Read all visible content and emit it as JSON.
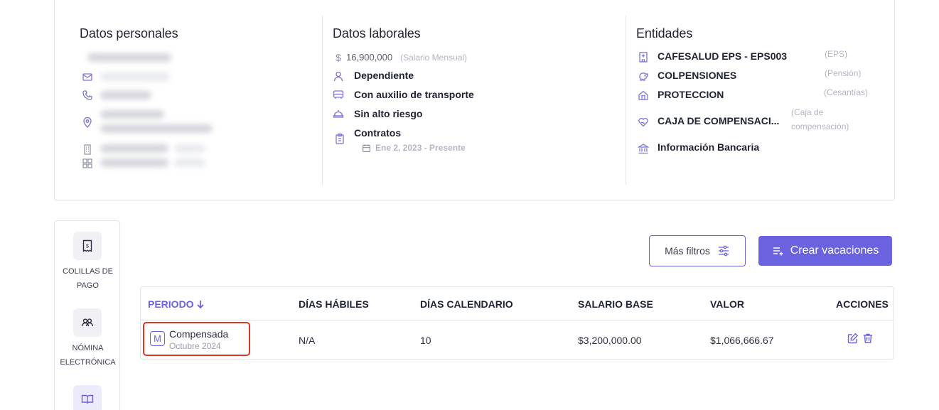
{
  "personal": {
    "title": "Datos personales"
  },
  "labor": {
    "title": "Datos laborales",
    "salary_value": "16,900,000",
    "salary_label": "(Salario Mensual)",
    "type": "Dependiente",
    "transport": "Con auxilio de transporte",
    "risk": "Sin alto riesgo",
    "contracts_label": "Contratos",
    "contract_date": "Ene 2, 2023 - Presente"
  },
  "entities": {
    "title": "Entidades",
    "items": [
      {
        "name": "CAFESALUD EPS - EPS003",
        "type": "(EPS)",
        "icon": "hospital-icon"
      },
      {
        "name": "COLPENSIONES",
        "type": "(Pensión)",
        "icon": "piggy-bank-icon"
      },
      {
        "name": "PROTECCION",
        "type": "(Cesantías)",
        "icon": "house-icon"
      },
      {
        "name": "CAJA DE COMPENSACI...",
        "type": "(Caja de compensación)",
        "type_line1": "(Caja de",
        "type_line2": "compensación)",
        "icon": "heart-hand-icon"
      },
      {
        "name": "Información Bancaria",
        "type": "",
        "icon": "bank-icon"
      }
    ]
  },
  "side_nav": {
    "items": [
      {
        "line1": "COLILLAS DE",
        "line2": "PAGO",
        "icon": "receipt-icon"
      },
      {
        "line1": "NÓMINA",
        "line2": "ELECTRÓNICA",
        "icon": "users-icon"
      },
      {
        "line1": "",
        "line2": "",
        "icon": "book-icon",
        "active": true
      }
    ]
  },
  "toolbar": {
    "filters_label": "Más filtros",
    "create_label": "Crear vacaciones"
  },
  "table": {
    "columns": [
      "PERIODO",
      "DÍAS HÁBILES",
      "DÍAS CALENDARIO",
      "SALARIO BASE",
      "VALOR",
      "ACCIONES"
    ],
    "rows": [
      {
        "badge": "M",
        "period": "Compensada",
        "period_sub": "Octubre 2024",
        "business_days": "N/A",
        "calendar_days": "10",
        "base_salary": "$3,200,000.00",
        "value": "$1,066,666.67"
      }
    ]
  },
  "colors": {
    "accent": "#6b62e0",
    "highlight": "#e0352b"
  }
}
